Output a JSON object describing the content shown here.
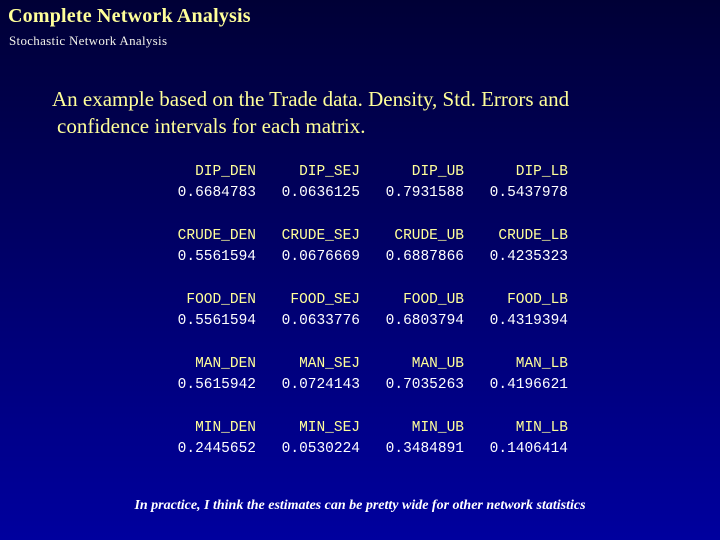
{
  "slide": {
    "title": "Complete Network Analysis",
    "subtitle": "Stochastic Network Analysis",
    "lead_line1": "An example based on the Trade data.  Density, Std. Errors and",
    "lead_line2": "confidence intervals for each matrix.",
    "footer": "In practice, I think the estimates can be pretty wide for other network statistics",
    "colors": {
      "background_top": "#000036",
      "background_bottom": "#00009e",
      "title": "#ffff99",
      "subtitle": "#f2f2ea",
      "lead": "#ffff99",
      "header_text": "#ffff99",
      "value_text": "#ffffff",
      "footer": "#ffffff"
    }
  },
  "matrices": [
    {
      "name": "DIP",
      "headers": [
        "DIP_DEN",
        "DIP_SEJ",
        "DIP_UB",
        "DIP_LB"
      ],
      "values": [
        "0.6684783",
        "0.0636125",
        "0.7931588",
        "0.5437978"
      ]
    },
    {
      "name": "CRUDE",
      "headers": [
        "CRUDE_DEN",
        "CRUDE_SEJ",
        "CRUDE_UB",
        "CRUDE_LB"
      ],
      "values": [
        "0.5561594",
        "0.0676669",
        "0.6887866",
        "0.4235323"
      ]
    },
    {
      "name": "FOOD",
      "headers": [
        "FOOD_DEN",
        "FOOD_SEJ",
        "FOOD_UB",
        "FOOD_LB"
      ],
      "values": [
        "0.5561594",
        "0.0633776",
        "0.6803794",
        "0.4319394"
      ]
    },
    {
      "name": "MAN",
      "headers": [
        "MAN_DEN",
        "MAN_SEJ",
        "MAN_UB",
        "MAN_LB"
      ],
      "values": [
        "0.5615942",
        "0.0724143",
        "0.7035263",
        "0.4196621"
      ]
    },
    {
      "name": "MIN",
      "headers": [
        "MIN_DEN",
        "MIN_SEJ",
        "MIN_UB",
        "MIN_LB"
      ],
      "values": [
        "0.2445652",
        "0.0530224",
        "0.3484891",
        "0.1406414"
      ]
    }
  ]
}
